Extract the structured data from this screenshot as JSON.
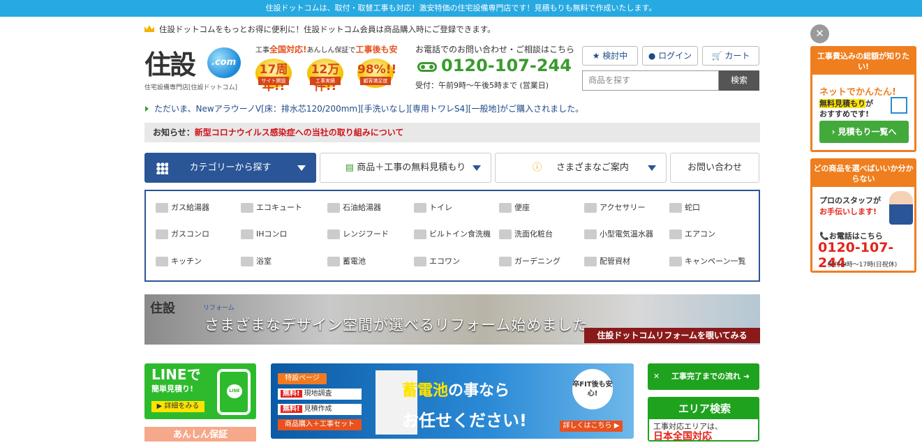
{
  "topbar": {
    "text": "住設ドットコムは、取付・取替工事も対応！激安特価の住宅設備専門店です！見積もりも無料で作成いたします。"
  },
  "header": {
    "member_text": "住設ドットコムをもっとお得に便利に！住設ドットコム会員は商品購入時にご登録できます。",
    "logo_kanji": "住設",
    "logo_dot": ".com",
    "logo_sub": "住宅設備専門店[住設ドットコム]",
    "anshin_prefix": "工事",
    "anshin_bold": "全国対応!",
    "anshin_mid": "あんしん保証で",
    "anshin_bold2": "工事後も安",
    "medals": [
      {
        "num": "17周年!!",
        "ribbon": "サイト開設"
      },
      {
        "num": "12万件!!",
        "ribbon": "工事実績"
      },
      {
        "num": "98%!!",
        "ribbon": "顧客満足度"
      }
    ],
    "tel_title": "お電話でのお問い合わせ・ご相談はこちら",
    "tel_number": "0120-107-244",
    "tel_hours": "受付：午前9時〜午後5時まで (営業日)",
    "btn_estimate": "検討中",
    "btn_login": "ログイン",
    "btn_cart": "カート",
    "search_placeholder": "商品を探す",
    "search_button": "検索"
  },
  "purchase_ticker": "ただいま、NewアラウーノV[床：排水芯120/200mm][手洗いなし][専用トワレS4][一般地]がご購入されました。",
  "notice": {
    "label": "お知らせ：",
    "link": "新型コロナウイルス感染症への当社の取り組みについて"
  },
  "nav": {
    "category": "カテゴリーから探す",
    "estimate": "商品＋工事の無料見積もり",
    "guide": "さまざまなご案内",
    "contact": "お問い合わせ"
  },
  "categories": [
    "ガス給湯器",
    "エコキュート",
    "石油給湯器",
    "トイレ",
    "便座",
    "アクセサリー",
    "蛇口",
    "ガスコンロ",
    "IHコンロ",
    "レンジフード",
    "ビルトイン食洗機",
    "洗面化粧台",
    "小型電気温水器",
    "エアコン",
    "キッチン",
    "浴室",
    "蓄電池",
    "エコワン",
    "ガーデニング",
    "配管資材",
    "キャンペーン一覧"
  ],
  "reform_banner": {
    "logo": "住設",
    "reform": "リフォーム",
    "catch": "さまざまなデザイン空間が選べるリフォーム始めました。",
    "look": "住設ドットコムリフォームを覗いてみる"
  },
  "line_banner": {
    "title": "LINEで",
    "sub": "簡単見積り!",
    "detail": "▶ 詳細をみる",
    "icon": "LINE"
  },
  "hosho_banner": "あんしん保証",
  "battery_banner": {
    "tokusetsu": "特設ページ",
    "row1_tag": "無料!",
    "row1": "現地調査",
    "row2_tag": "無料!",
    "row2": "見積作成",
    "row3": "商品購入＋工事セット",
    "h1a": "蓄電池",
    "h1b": "の事なら",
    "h2": "お任せください!",
    "fit": "卒FIT後も安心!",
    "more": "詳しくはこちら ▶"
  },
  "flow_banner": "工事完了までの流れ ➜",
  "area_banner": {
    "title": "エリア検索",
    "sub": "工事対応エリアは、",
    "big": "日本全国対応"
  },
  "side1": {
    "head": "工事費込みの総額が知りたい!",
    "l1": "ネットでかんたん!",
    "l2a": "無料見積もり",
    "l2b": "が",
    "l3": "おすすめです!",
    "btn": "› 見積もり一覧へ"
  },
  "side2": {
    "head": "どの商品を選べばいいか分からない",
    "l1": "プロのスタッフが",
    "l2": "お手伝いします!",
    "tel_label": "📞お電話はこちら",
    "tel": "0120-107-244",
    "hours": "受付:9時〜17時(日祝休)"
  },
  "colors": {
    "accent": "#27a9e1",
    "nav_active": "#2a5597",
    "tel_green": "#3a9b2e",
    "orange": "#ef7e1f"
  }
}
